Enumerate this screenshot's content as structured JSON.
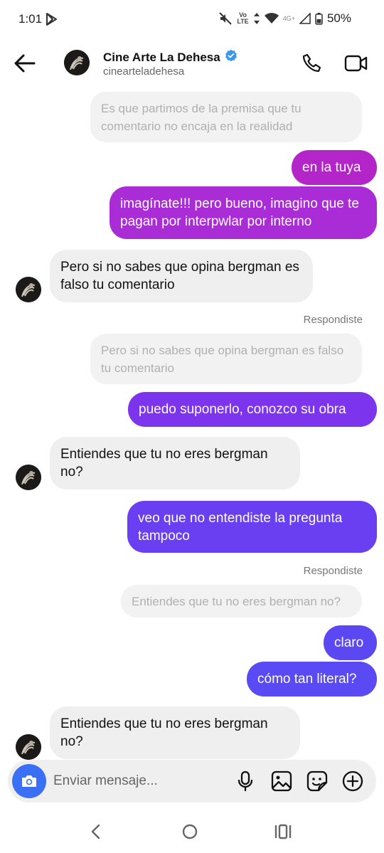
{
  "status_bar": {
    "time": "1:01",
    "volte_top": "Vo",
    "volte_bottom": "LTE",
    "network": "4G+",
    "battery": "50%"
  },
  "header": {
    "title": "Cine Arte La Dehesa",
    "handle": "cinearteladehesa",
    "verified_color": "#3897f0"
  },
  "messages": [
    {
      "type": "reply",
      "text": "Es que partimos de la premisa que tu comentario no encaja en la realidad"
    },
    {
      "type": "out",
      "text": "en la tuya",
      "color": "#b325c8"
    },
    {
      "type": "out",
      "text": "imagínate!!! pero bueno, imagino que te pagan por interpwlar por interno",
      "color": "#a92cd6"
    },
    {
      "type": "in",
      "text": "Pero si no sabes que opina bergman es falso tu comentario"
    },
    {
      "type": "replied_label",
      "text": "Respondiste"
    },
    {
      "type": "reply",
      "text": "Pero si no sabes que opina bergman es falso tu comentario"
    },
    {
      "type": "out",
      "text": "puedo suponerlo, conozco su obra",
      "color": "#7c34ec"
    },
    {
      "type": "in",
      "text": "Entiendes que tu no eres bergman no?"
    },
    {
      "type": "out",
      "text": "veo que no entendiste la pregunta tampoco",
      "color": "#6a3ff2"
    },
    {
      "type": "replied_label",
      "text": "Respondiste"
    },
    {
      "type": "reply",
      "text": "Entiendes que tu no eres bergman no?"
    },
    {
      "type": "out",
      "text": "claro",
      "color": "#5c48f3"
    },
    {
      "type": "out",
      "text": "cómo tan literal?",
      "color": "#5a4af3"
    },
    {
      "type": "in",
      "text": "Entiendes que tu no eres bergman no?"
    }
  ],
  "composer": {
    "placeholder": "Enviar mensaje...",
    "camera_color": "#3b6ff5"
  },
  "icons": {
    "back": "arrow-left-icon",
    "call": "phone-icon",
    "video": "video-camera-icon",
    "camera": "camera-icon",
    "mic": "microphone-icon",
    "gallery": "image-icon",
    "sticker": "sticker-icon",
    "add": "plus-circle-icon"
  }
}
